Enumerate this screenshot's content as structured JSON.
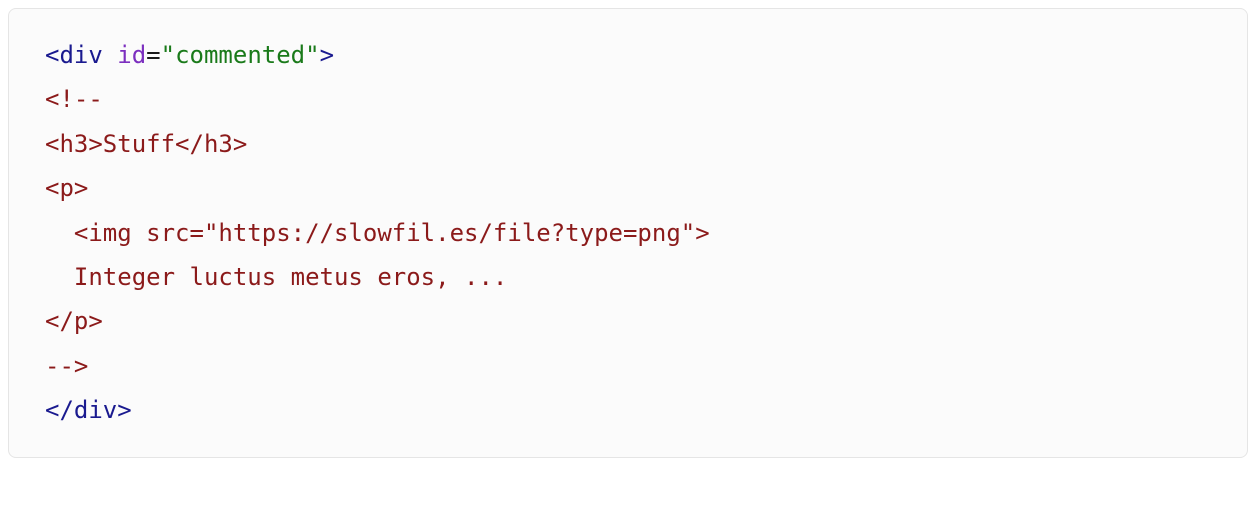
{
  "code": {
    "line1": {
      "open_bracket": "<",
      "tag": "div",
      "space": " ",
      "attr": "id",
      "equals": "=",
      "value": "\"commented\"",
      "close_bracket": ">"
    },
    "line2": "<!--",
    "line3": "<h3>Stuff</h3>",
    "line4": "<p>",
    "line5": "  <img src=\"https://slowfil.es/file?type=png\">",
    "line6": "  Integer luctus metus eros, ...",
    "line7": "</p>",
    "line8": "-->",
    "line9": {
      "open_bracket": "</",
      "tag": "div",
      "close_bracket": ">"
    }
  }
}
